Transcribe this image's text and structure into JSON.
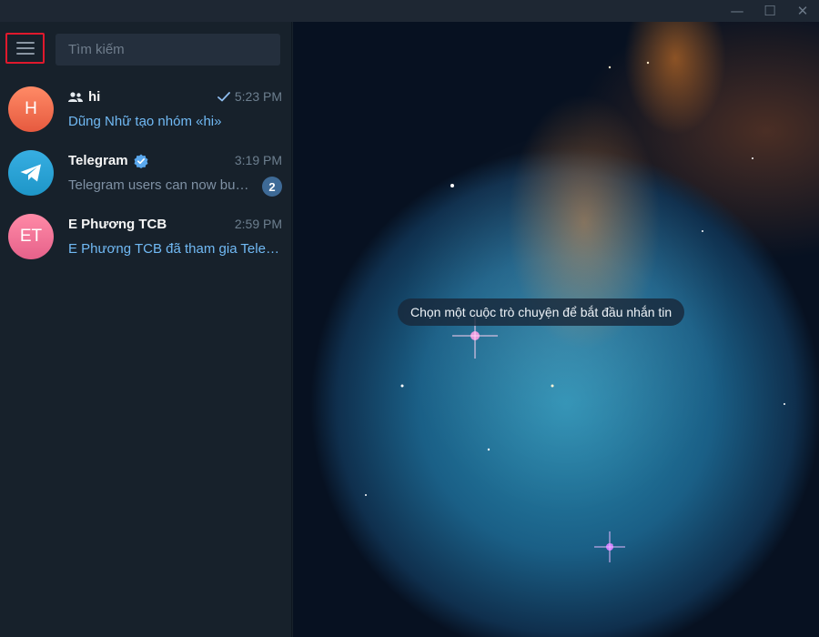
{
  "window": {
    "controls": [
      "minimize-icon",
      "maximize-icon",
      "close-icon"
    ]
  },
  "sidebar": {
    "menu_icon": "hamburger-menu-icon",
    "search": {
      "placeholder": "Tìm kiếm",
      "value": ""
    },
    "chats": [
      {
        "avatar_initials": "H",
        "avatar_color": "#ff7a55",
        "name": "hi",
        "name_icon": "group-icon",
        "time": "5:23 PM",
        "read_status": "check-icon",
        "preview": "Dũng Nhữ tạo nhóm «hi»"
      },
      {
        "avatar_initials": "",
        "avatar_icon": "telegram-logo-icon",
        "avatar_color": "#2aa3dd",
        "name": "Telegram",
        "verified_icon": "verified-badge-icon",
        "time": "3:19 PM",
        "preview": "Telegram users can now buy…",
        "unread_count": "2"
      },
      {
        "avatar_initials": "ET",
        "avatar_color": "#f4789a",
        "name": "E Phương TCB",
        "time": "2:59 PM",
        "preview": "E Phương TCB đã tham gia Teleg…"
      }
    ]
  },
  "main": {
    "empty_state": "Chọn một cuộc trò chuyện để bắt đầu nhắn tin"
  },
  "colors": {
    "sidebar_bg": "#17212b",
    "search_bg": "#242f3d",
    "link_text": "#71baf5",
    "muted_text": "#7f91a4",
    "highlight_border": "#e0192d",
    "unread_badge": "#3e6a96"
  }
}
